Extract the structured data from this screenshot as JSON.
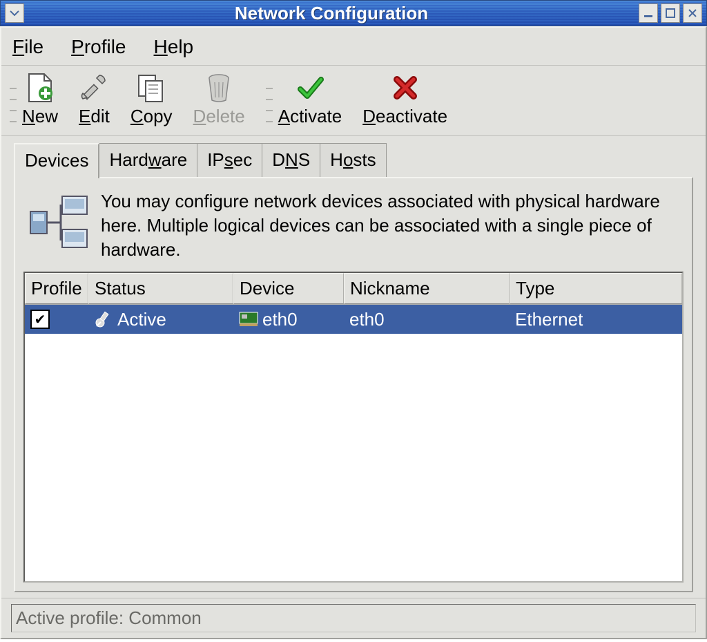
{
  "window": {
    "title": "Network Configuration"
  },
  "menubar": {
    "file": "File",
    "profile": "Profile",
    "help": "Help"
  },
  "toolbar": {
    "new": "New",
    "edit": "Edit",
    "copy": "Copy",
    "delete": "Delete",
    "activate": "Activate",
    "deactivate": "Deactivate"
  },
  "tabs": {
    "devices": "Devices",
    "hardware": "Hardware",
    "ipsec": "IPsec",
    "dns": "DNS",
    "hosts": "Hosts"
  },
  "panel": {
    "description": "You may configure network devices associated with physical hardware here.  Multiple logical devices can be associated with a single piece of hardware."
  },
  "table": {
    "headers": {
      "profile": "Profile",
      "status": "Status",
      "device": "Device",
      "nickname": "Nickname",
      "type": "Type"
    },
    "rows": [
      {
        "profile_checked": true,
        "status": "Active",
        "device": "eth0",
        "nickname": "eth0",
        "type": "Ethernet"
      }
    ]
  },
  "statusbar": {
    "text": "Active profile: Common"
  }
}
